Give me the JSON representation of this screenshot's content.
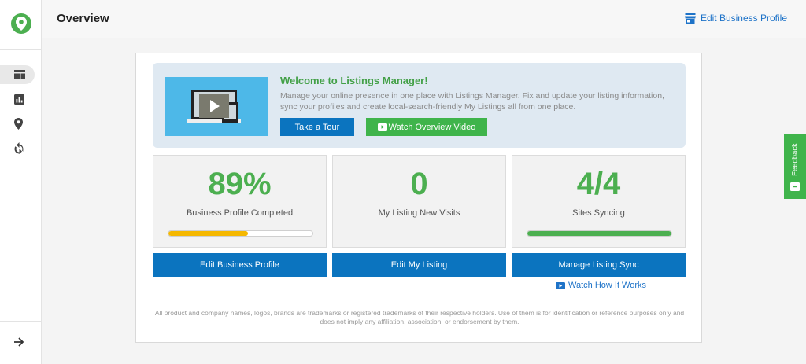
{
  "header": {
    "title": "Overview",
    "edit_link": "Edit Business Profile"
  },
  "sidebar": {
    "items": [
      {
        "icon": "dashboard-icon",
        "active": true
      },
      {
        "icon": "bar-chart-icon",
        "active": false
      },
      {
        "icon": "map-pin-icon",
        "active": false
      },
      {
        "icon": "sync-icon",
        "active": false
      }
    ],
    "expand_icon": "arrow-right-icon"
  },
  "welcome": {
    "title": "Welcome to Listings Manager!",
    "description": "Manage your online presence in one place with Listings Manager. Fix and update your listing information, sync your profiles and create local-search-friendly My Listings all from one place.",
    "tour_button": "Take a Tour",
    "video_button": "Watch Overview Video"
  },
  "stats": [
    {
      "value": "89%",
      "label": "Business Profile Completed",
      "progress": 0.55,
      "bar_color": "#f5b800"
    },
    {
      "value": "0",
      "label": "My Listing New Visits"
    },
    {
      "value": "4/4",
      "label": "Sites Syncing",
      "progress": 1.0,
      "bar_color": "#4caf50"
    }
  ],
  "actions": {
    "edit_profile": "Edit Business Profile",
    "edit_listing": "Edit My Listing",
    "manage_sync": "Manage Listing Sync",
    "watch_link": "Watch How It Works"
  },
  "footer": "All product and company names, logos, brands are trademarks or registered trademarks of their respective holders. Use of them is for identification or reference purposes only and does not imply any affiliation, association, or endorsement by them.",
  "feedback": "Feedback",
  "colors": {
    "brand_green": "#4caf50",
    "primary_blue": "#0b74bf",
    "link_blue": "#1e73c8",
    "progress_yellow": "#f5b800"
  }
}
